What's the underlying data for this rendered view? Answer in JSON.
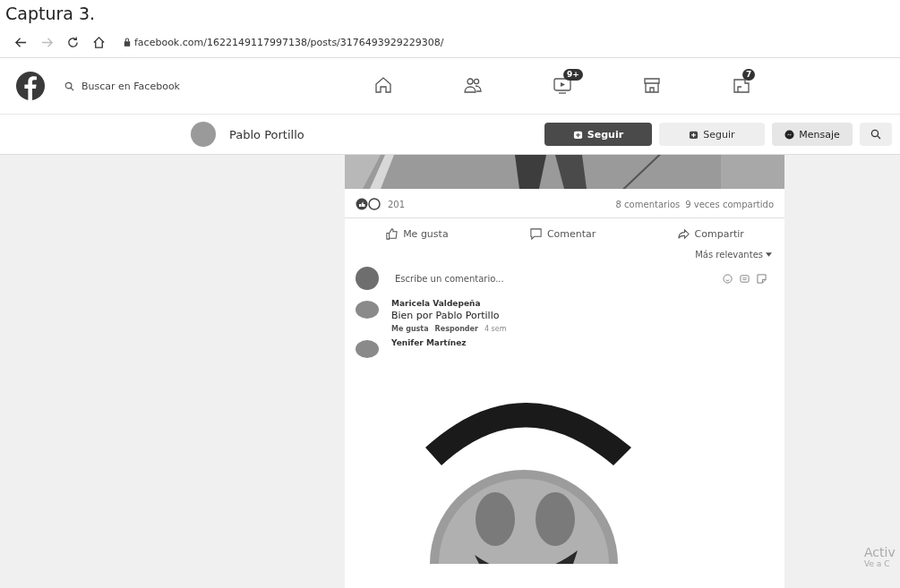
{
  "caption": "Captura 3.",
  "browser": {
    "url": "facebook.com/1622149117997138/posts/3176493929229308/"
  },
  "navbar": {
    "search": {
      "placeholder": "Buscar en Facebook"
    },
    "tabs": [
      {
        "kind": "home"
      },
      {
        "kind": "friends"
      },
      {
        "kind": "watch",
        "badge": "9+"
      },
      {
        "kind": "marketplace"
      },
      {
        "kind": "gaming",
        "badge": "7"
      }
    ]
  },
  "profile_bar": {
    "name": "Pablo Portillo",
    "buttons": [
      {
        "kind": "primary",
        "label": "Seguir"
      },
      {
        "kind": "secondary",
        "label": "Seguir"
      },
      {
        "kind": "message",
        "label": "Mensaje"
      },
      {
        "kind": "search"
      }
    ]
  },
  "post": {
    "reactions_count": "201",
    "comments_count": "8 comentarios",
    "shares_count": "9 veces compartido",
    "actions": [
      {
        "kind": "like",
        "label": "Me gusta"
      },
      {
        "kind": "comment",
        "label": "Comentar"
      },
      {
        "kind": "share",
        "label": "Compartir"
      }
    ],
    "sort": "Más relevantes",
    "comment_box": {
      "placeholder": "Escribe un comentario..."
    },
    "comments": [
      {
        "author": "Maricela Valdepeña",
        "text": "Bien por Pablo Portillo",
        "actions": [
          "Me gusta",
          "Responder"
        ],
        "time": "4 sem"
      },
      {
        "author": "Yenifer Martínez"
      }
    ]
  },
  "activation_notice": [
    "Activ",
    "Ve a C"
  ]
}
